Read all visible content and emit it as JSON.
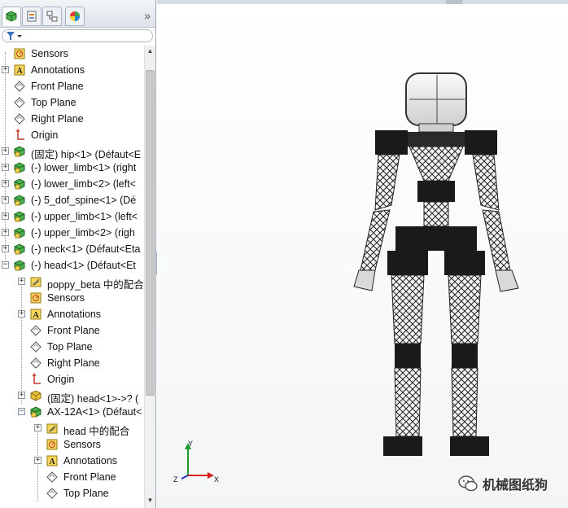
{
  "tabs": [
    {
      "name": "featuremanager-tab-icon",
      "active": true
    },
    {
      "name": "property-manager-tab-icon",
      "active": false
    },
    {
      "name": "configuration-manager-tab-icon",
      "active": false
    },
    {
      "name": "display-manager-tab-icon",
      "active": false
    }
  ],
  "collapse_glyph": "»",
  "tree": [
    {
      "label": "Sensors",
      "level": 0,
      "icon": "sensor",
      "expander": ""
    },
    {
      "label": "Annotations",
      "level": 0,
      "icon": "annotation",
      "expander": "+"
    },
    {
      "label": "Front Plane",
      "level": 0,
      "icon": "plane",
      "expander": ""
    },
    {
      "label": "Top Plane",
      "level": 0,
      "icon": "plane",
      "expander": ""
    },
    {
      "label": "Right Plane",
      "level": 0,
      "icon": "plane",
      "expander": ""
    },
    {
      "label": "Origin",
      "level": 0,
      "icon": "origin",
      "expander": ""
    },
    {
      "label": "(固定) hip<1> (Défaut<E",
      "level": 0,
      "icon": "part",
      "expander": "+"
    },
    {
      "label": "(-) lower_limb<1> (right",
      "level": 0,
      "icon": "part",
      "expander": "+"
    },
    {
      "label": "(-) lower_limb<2> (left<",
      "level": 0,
      "icon": "part",
      "expander": "+"
    },
    {
      "label": "(-) 5_dof_spine<1> (Dé",
      "level": 0,
      "icon": "part",
      "expander": "+"
    },
    {
      "label": "(-) upper_limb<1> (left<",
      "level": 0,
      "icon": "part",
      "expander": "+"
    },
    {
      "label": "(-) upper_limb<2> (righ",
      "level": 0,
      "icon": "part",
      "expander": "+"
    },
    {
      "label": "(-) neck<1> (Défaut<Eta",
      "level": 0,
      "icon": "part",
      "expander": "+"
    },
    {
      "label": "(-) head<1> (Défaut<Et",
      "level": 0,
      "icon": "part",
      "expander": "-"
    },
    {
      "label": "poppy_beta 中的配合",
      "level": 1,
      "icon": "mates",
      "expander": "+"
    },
    {
      "label": "Sensors",
      "level": 1,
      "icon": "sensor",
      "expander": ""
    },
    {
      "label": "Annotations",
      "level": 1,
      "icon": "annotation",
      "expander": "+"
    },
    {
      "label": "Front Plane",
      "level": 1,
      "icon": "plane",
      "expander": ""
    },
    {
      "label": "Top Plane",
      "level": 1,
      "icon": "plane",
      "expander": ""
    },
    {
      "label": "Right Plane",
      "level": 1,
      "icon": "plane",
      "expander": ""
    },
    {
      "label": "Origin",
      "level": 1,
      "icon": "origin",
      "expander": ""
    },
    {
      "label": "(固定) head<1>->? (",
      "level": 1,
      "icon": "part-yellow",
      "expander": "+"
    },
    {
      "label": "AX-12A<1> (Défaut<",
      "level": 1,
      "icon": "part",
      "expander": "-"
    },
    {
      "label": "head 中的配合",
      "level": 2,
      "icon": "mates",
      "expander": "+"
    },
    {
      "label": "Sensors",
      "level": 2,
      "icon": "sensor",
      "expander": ""
    },
    {
      "label": "Annotations",
      "level": 2,
      "icon": "annotation",
      "expander": "+"
    },
    {
      "label": "Front Plane",
      "level": 2,
      "icon": "plane",
      "expander": ""
    },
    {
      "label": "Top Plane",
      "level": 2,
      "icon": "plane",
      "expander": ""
    }
  ],
  "triad": {
    "x_label": "X",
    "y_label": "Y",
    "z_label": "Z"
  },
  "watermark": {
    "text": "机械图纸狗"
  },
  "colors": {
    "part_green": "#3c9a3c",
    "part_yellow": "#e8c23a",
    "triad_x": "#d32222",
    "triad_y": "#1f9a2e",
    "triad_z": "#2233cc"
  }
}
